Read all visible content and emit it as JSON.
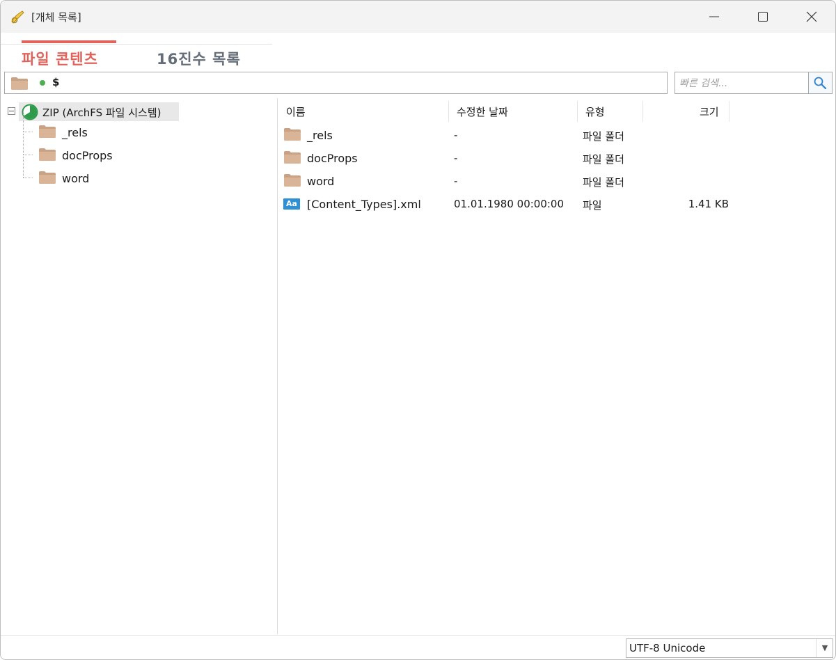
{
  "window": {
    "title": "[개체 목록]"
  },
  "tabs": [
    {
      "label": "파일 콘텐츠",
      "active": true
    },
    {
      "label": "16진수 목록",
      "active": false
    }
  ],
  "path": {
    "value": "$",
    "status_color": "#4caf50"
  },
  "search": {
    "placeholder": "빠른 검색..."
  },
  "tree": {
    "root_label": "ZIP (ArchFS 파일 시스템)",
    "children": [
      "_rels",
      "docProps",
      "word"
    ]
  },
  "filelist": {
    "columns": [
      "이름",
      "수정한 날짜",
      "유형",
      "크기"
    ],
    "rows": [
      {
        "icon": "folder-icon",
        "name": "_rels",
        "date": "-",
        "type": "파일 폴더",
        "size": ""
      },
      {
        "icon": "folder-icon",
        "name": "docProps",
        "date": "-",
        "type": "파일 폴더",
        "size": ""
      },
      {
        "icon": "folder-icon",
        "name": "word",
        "date": "-",
        "type": "파일 폴더",
        "size": ""
      },
      {
        "icon": "text-file-icon",
        "name": "[Content_Types].xml",
        "date": "01.01.1980 00:00:00",
        "type": "파일",
        "size": "1.41 KB",
        "icon_text": "Aa"
      }
    ]
  },
  "statusbar": {
    "encoding": "UTF-8 Unicode",
    "dropdown_arrow": "▼"
  },
  "colors": {
    "accent": "#e0625b",
    "inactive_tab": "#656d78",
    "file_icon": "#2d8fd4",
    "folder": "#c9a184"
  }
}
